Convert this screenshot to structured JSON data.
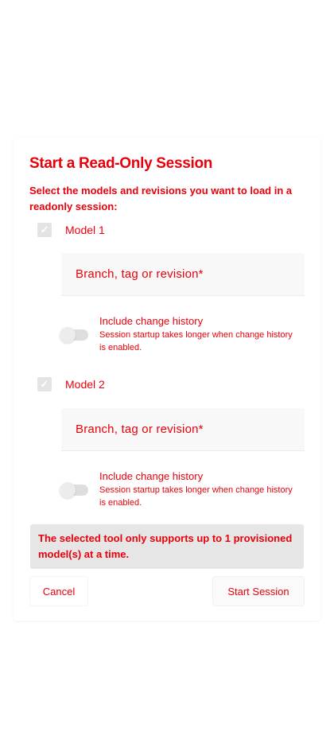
{
  "dialog": {
    "title": "Start a Read-Only Session",
    "description": "Select the models and revisions you want to load in a readonly session:",
    "models": [
      {
        "label": "Model 1",
        "checked": true,
        "field_label": "Branch, tag or revision*",
        "toggle_title": "Include change history",
        "toggle_hint": "Session startup takes longer when change history is enabled.",
        "toggle_on": false
      },
      {
        "label": "Model 2",
        "checked": true,
        "field_label": "Branch, tag or revision*",
        "toggle_title": "Include change history",
        "toggle_hint": "Session startup takes longer when change history is enabled.",
        "toggle_on": false
      }
    ],
    "notice": "The selected tool only supports up to 1 provisioned model(s) at a time.",
    "cancel_label": "Cancel",
    "start_label": "Start Session"
  },
  "colors": {
    "text": "#e8000b",
    "notice_bg": "#e6e6e6",
    "field_bg": "#f8f8f8"
  },
  "icons": {
    "checkbox_mark": "check-icon"
  }
}
